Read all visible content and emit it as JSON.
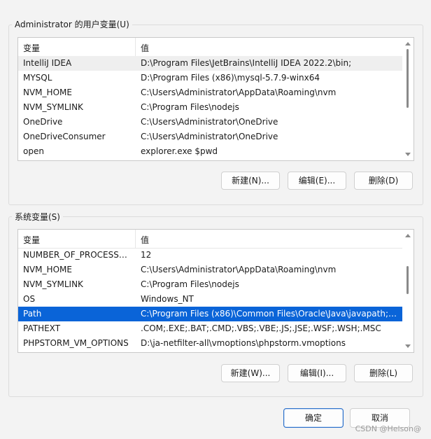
{
  "user_vars": {
    "title": "Administrator 的用户变量(U)",
    "col_var": "变量",
    "col_val": "值",
    "rows": [
      {
        "name": "IntelliJ IDEA",
        "value": "D:\\Program Files\\JetBrains\\IntelliJ IDEA 2022.2\\bin;"
      },
      {
        "name": "MYSQL",
        "value": "D:\\Program Files (x86)\\mysql-5.7.9-winx64"
      },
      {
        "name": "NVM_HOME",
        "value": "C:\\Users\\Administrator\\AppData\\Roaming\\nvm"
      },
      {
        "name": "NVM_SYMLINK",
        "value": "C:\\Program Files\\nodejs"
      },
      {
        "name": "OneDrive",
        "value": "C:\\Users\\Administrator\\OneDrive"
      },
      {
        "name": "OneDriveConsumer",
        "value": "C:\\Users\\Administrator\\OneDrive"
      },
      {
        "name": "open",
        "value": "explorer.exe $pwd"
      }
    ],
    "buttons": {
      "new": "新建(N)...",
      "edit": "编辑(E)...",
      "delete": "删除(D)"
    }
  },
  "system_vars": {
    "title": "系统变量(S)",
    "col_var": "变量",
    "col_val": "值",
    "rows": [
      {
        "name": "NUMBER_OF_PROCESSORS",
        "value": "12"
      },
      {
        "name": "NVM_HOME",
        "value": "C:\\Users\\Administrator\\AppData\\Roaming\\nvm"
      },
      {
        "name": "NVM_SYMLINK",
        "value": "C:\\Program Files\\nodejs"
      },
      {
        "name": "OS",
        "value": "Windows_NT"
      },
      {
        "name": "Path",
        "value": "C:\\Program Files (x86)\\Common Files\\Oracle\\Java\\javapath;C:..."
      },
      {
        "name": "PATHEXT",
        "value": ".COM;.EXE;.BAT;.CMD;.VBS;.VBE;.JS;.JSE;.WSF;.WSH;.MSC"
      },
      {
        "name": "PHPSTORM_VM_OPTIONS",
        "value": "D:\\ja-netfilter-all\\vmoptions\\phpstorm.vmoptions"
      }
    ],
    "selected_row": "Path",
    "buttons": {
      "new": "新建(W)...",
      "edit": "编辑(I)...",
      "delete": "删除(L)"
    }
  },
  "dialog_buttons": {
    "ok": "确定",
    "cancel": "取消"
  },
  "watermark": "CSDN @Helson@",
  "colors": {
    "selection": "#0a64d8",
    "primary_border": "#2a6fc9",
    "background": "#f3f3f3"
  }
}
